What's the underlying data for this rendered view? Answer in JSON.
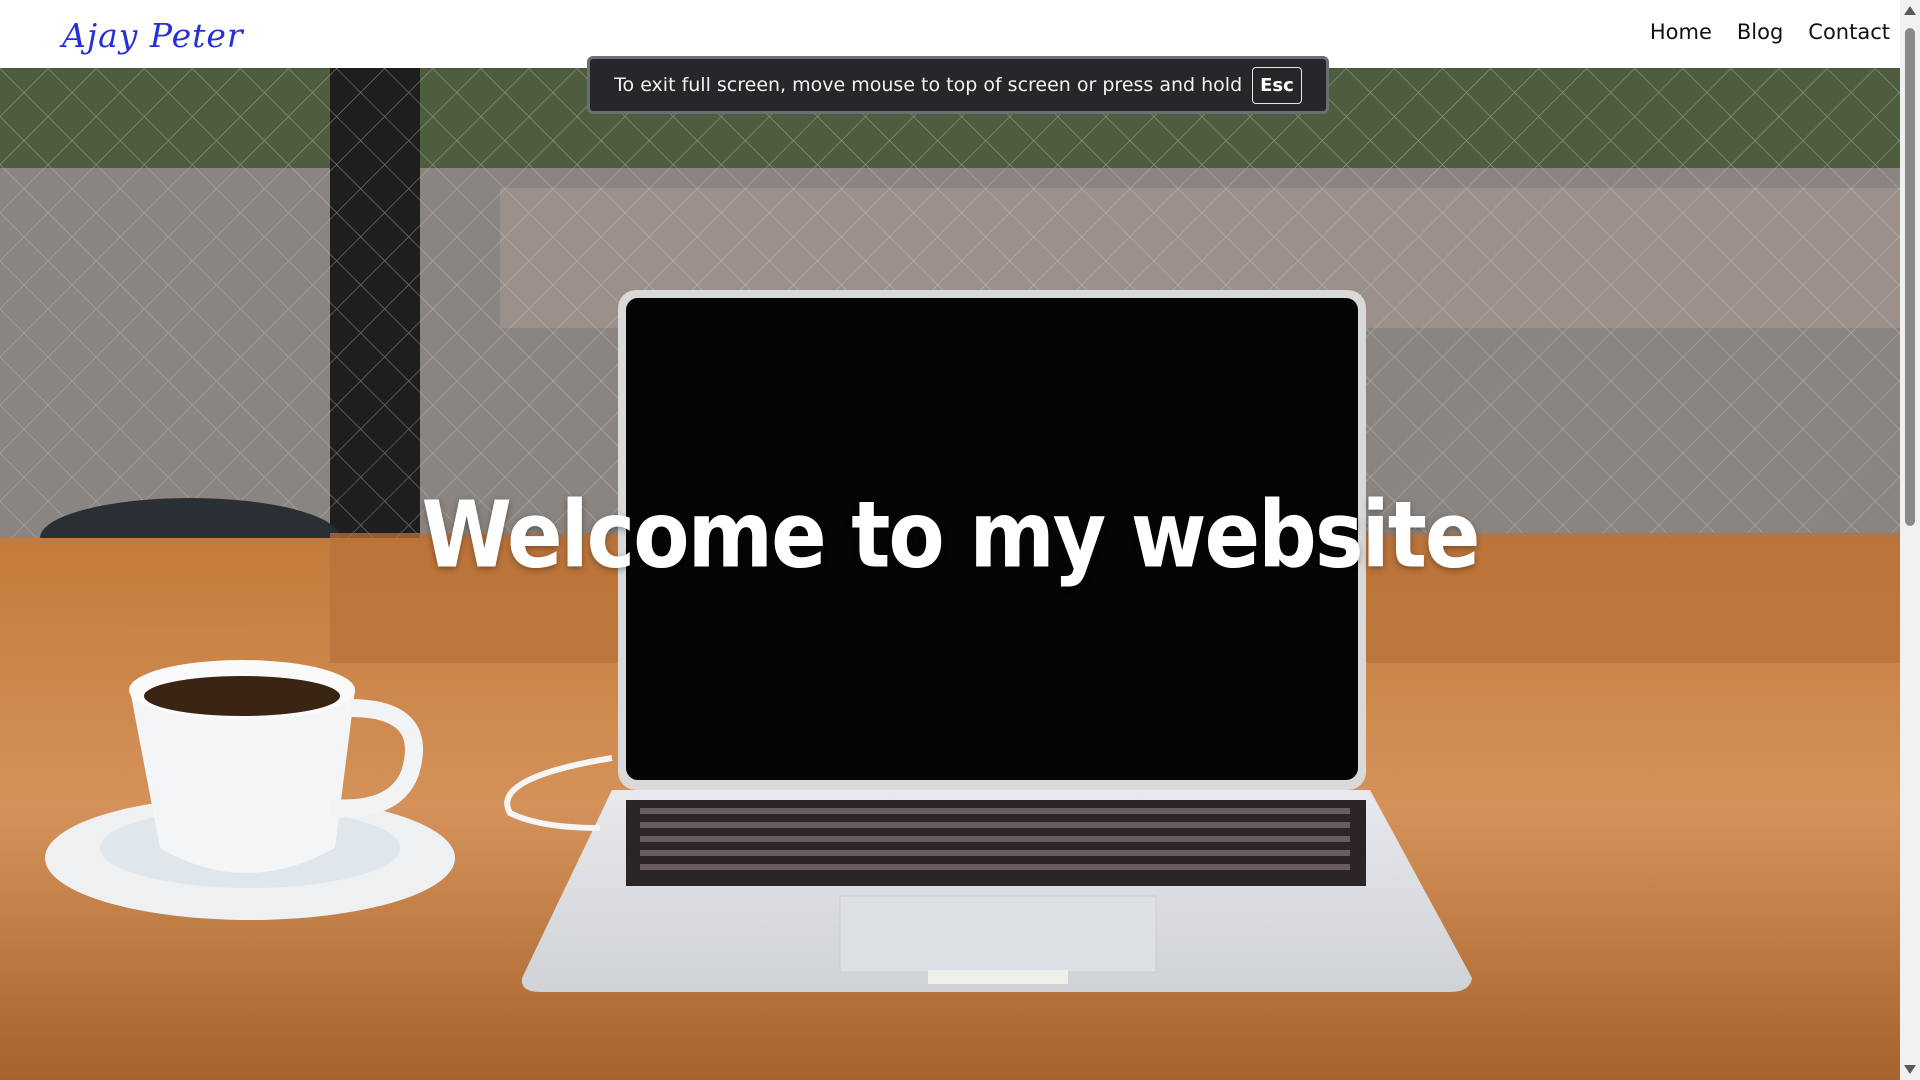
{
  "navbar": {
    "brand": "Ajay Peter",
    "links": [
      "Home",
      "Blog",
      "Contact"
    ]
  },
  "hero": {
    "title": "Welcome to my website"
  },
  "fullscreen_notice": {
    "message": "To exit full screen, move mouse to top of screen or press and hold",
    "key": "Esc"
  },
  "colors": {
    "brand": "#2430d8",
    "toast_bg": "#25272b",
    "hero_title": "#ffffff"
  }
}
